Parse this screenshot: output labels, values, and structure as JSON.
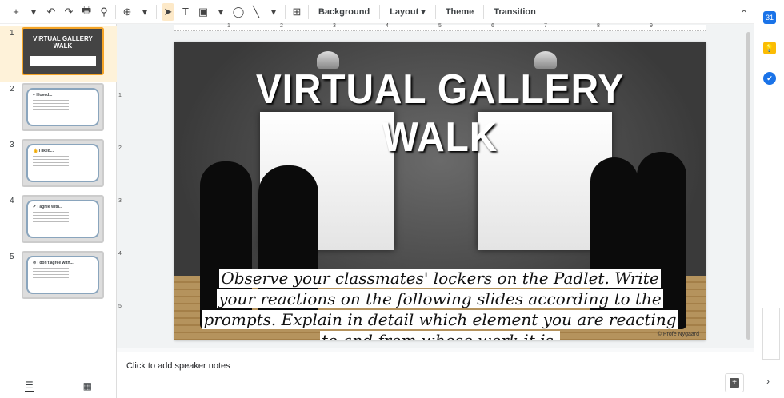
{
  "toolbar": {
    "new": "+",
    "new_dd": "▾",
    "undo": "↶",
    "redo": "↷",
    "print": "🖶",
    "paint": "⚲",
    "zoom": "⊕",
    "zoom_dd": "▾",
    "select": "➤",
    "textbox": "T",
    "image": "▣",
    "image_dd": "▾",
    "shape": "◯",
    "line": "╲",
    "line_dd": "▾",
    "comment": "⊞",
    "background": "Background",
    "layout": "Layout ▾",
    "theme": "Theme",
    "transition": "Transition",
    "collapse": "⌃"
  },
  "filmstrip": {
    "slides": [
      {
        "num": "1",
        "title": "VIRTUAL GALLERY WALK"
      },
      {
        "num": "2",
        "title": "♥ I loved..."
      },
      {
        "num": "3",
        "title": "👍 I liked..."
      },
      {
        "num": "4",
        "title": "✔ I agree with..."
      },
      {
        "num": "5",
        "title": "⊘ I don't agree with..."
      }
    ],
    "view_list": "☰",
    "view_grid": "▦"
  },
  "ruler": {
    "h": [
      "1",
      "2",
      "3",
      "4",
      "5",
      "6",
      "7",
      "8",
      "9"
    ],
    "v": [
      "1",
      "2",
      "3",
      "4",
      "5"
    ]
  },
  "slide": {
    "title": "VIRTUAL GALLERY WALK",
    "caption": "Observe your classmates' lockers on the Padlet. Write your reactions on the following slides according to the prompts. Explain in detail which element you are reacting to and from whose work it is.",
    "credit": "© Profe Nygaard"
  },
  "notes": {
    "placeholder": "Click to add speaker notes",
    "add_comment": "+"
  },
  "side": {
    "calendar": "31",
    "keep": "💡",
    "tasks": "✔",
    "expand": "›"
  }
}
